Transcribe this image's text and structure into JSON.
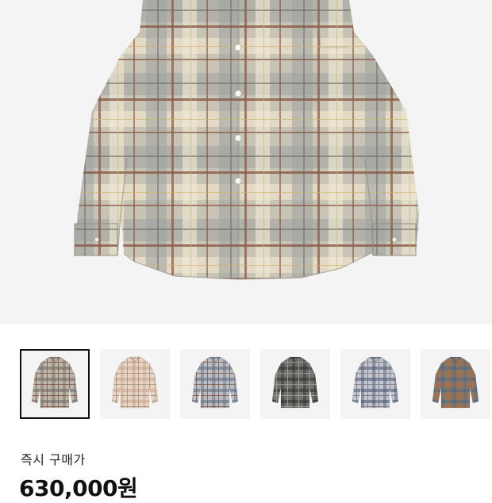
{
  "product": {
    "main_image": "plaid-flannel-shirt-main",
    "gallery": [
      {
        "name": "grey-beige-plaid-shirt",
        "base": "#bdb8ac",
        "line_a": "#6f6a63",
        "line_b": "#8a5a46",
        "selected": true
      },
      {
        "name": "beige-pink-plaid-shirt",
        "base": "#e5d7c8",
        "line_a": "#c9a48f",
        "line_b": "#b98e78",
        "selected": false
      },
      {
        "name": "blue-brown-plaid-shirt",
        "base": "#b9bfc5",
        "line_a": "#5d6c80",
        "line_b": "#8d5f48",
        "selected": false
      },
      {
        "name": "black-grey-plaid-shirt",
        "base": "#6f716d",
        "line_a": "#2f302f",
        "line_b": "#9a9d97",
        "selected": false
      },
      {
        "name": "navy-blue-plaid-shirt",
        "base": "#c3c6cf",
        "line_a": "#485571",
        "line_b": "#7f7a88",
        "selected": false
      },
      {
        "name": "brown-blue-plaid-shirt",
        "base": "#8c7764",
        "line_a": "#4b6a86",
        "line_b": "#b4683c",
        "selected": false
      }
    ]
  },
  "pricing": {
    "label": "즉시 구매가",
    "price": "630,000원"
  }
}
